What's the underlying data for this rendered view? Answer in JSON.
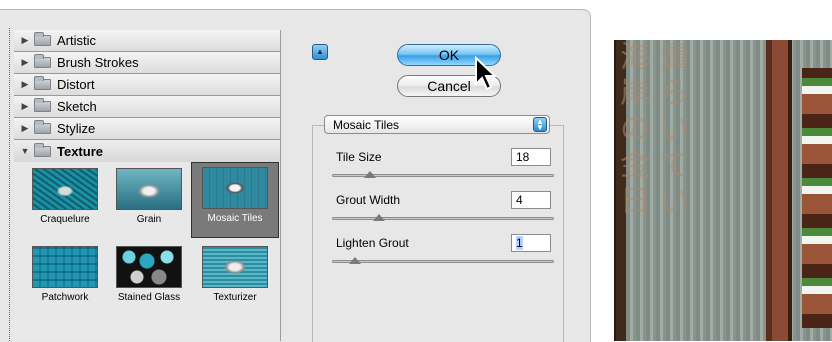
{
  "filter_tree": {
    "categories": [
      {
        "label": "Artistic",
        "expanded": false
      },
      {
        "label": "Brush Strokes",
        "expanded": false
      },
      {
        "label": "Distort",
        "expanded": false
      },
      {
        "label": "Sketch",
        "expanded": false
      },
      {
        "label": "Stylize",
        "expanded": false
      },
      {
        "label": "Texture",
        "expanded": true
      }
    ],
    "texture_filters": [
      {
        "label": "Craquelure",
        "selected": false
      },
      {
        "label": "Grain",
        "selected": false
      },
      {
        "label": "Mosaic Tiles",
        "selected": true
      },
      {
        "label": "Patchwork",
        "selected": false
      },
      {
        "label": "Stained Glass",
        "selected": false
      },
      {
        "label": "Texturizer",
        "selected": false
      }
    ]
  },
  "buttons": {
    "ok_label": "OK",
    "cancel_label": "Cancel",
    "collapse_icon": "triangle-up-icon"
  },
  "settings": {
    "filter_select": "Mosaic Tiles",
    "params": [
      {
        "label": "Tile Size",
        "value": "18",
        "slider_fraction": 0.17
      },
      {
        "label": "Grout Width",
        "value": "4",
        "slider_fraction": 0.21
      },
      {
        "label": "Lighten Grout",
        "value": "1",
        "slider_fraction": 0.1
      }
    ]
  },
  "preview_photo": {
    "glyphs": "海 貴\n岸 ら\nの い\n金 て\n日 い\n"
  },
  "colors": {
    "ok_button": "#3aa0e6",
    "selected_thumb": "#7a7a7a"
  }
}
